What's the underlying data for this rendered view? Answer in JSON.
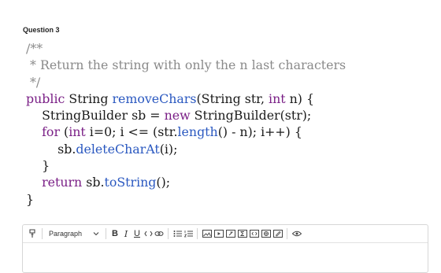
{
  "question": {
    "label": "Question 3"
  },
  "code": {
    "comment_open": "/**",
    "comment_body": " * Return the string with only the n last characters",
    "comment_close": " */",
    "l1_kw": "public",
    "l1_type": " String ",
    "l1_fn": "removeChars",
    "l1_rest_a": "(String str, ",
    "l1_kw2": "int",
    "l1_rest_b": " n) {",
    "l2_a": "    StringBuilder sb = ",
    "l2_kw": "new",
    "l2_b": " StringBuilder(str);",
    "l3_kw": "    for",
    "l3_a": " (",
    "l3_kw2": "int",
    "l3_b": " i=0; i <= (str.",
    "l3_fn": "length",
    "l3_c": "() - n); i++) {",
    "l4_a": "        sb.",
    "l4_fn": "deleteCharAt",
    "l4_b": "(i);",
    "l5": "    }",
    "l6_kw": "    return",
    "l6_a": " sb.",
    "l6_fn": "toString",
    "l6_b": "();",
    "l7": "}"
  },
  "editor": {
    "paragraph_select": "Paragraph",
    "bold": "B",
    "italic": "I",
    "underline": "U",
    "icons": [
      "format-painter-icon",
      "chevron-down-icon",
      "code-icon",
      "link-icon",
      "bulleted-list-icon",
      "numbered-list-icon",
      "image-icon",
      "media-icon",
      "attachment-icon",
      "equation-icon",
      "embed-icon",
      "globe-icon",
      "draw-icon",
      "eye-icon"
    ]
  }
}
